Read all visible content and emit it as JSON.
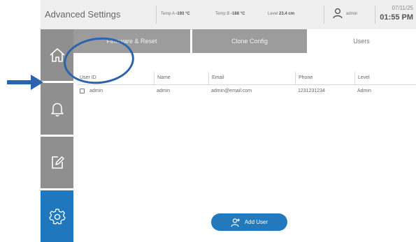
{
  "header": {
    "title": "Advanced Settings",
    "temp_a_label": "Temp A",
    "temp_a_value": "-193 °C",
    "temp_b_label": "Temp B",
    "temp_b_value": "-188 °C",
    "level_label": "Level",
    "level_value": "23.4 cm",
    "user": "admin",
    "date": "07/11/25",
    "time": "01:55 PM"
  },
  "sidebar": {
    "items": [
      {
        "name": "home",
        "icon": "home-icon",
        "active": false
      },
      {
        "name": "alarms",
        "icon": "bell-icon",
        "active": false
      },
      {
        "name": "logs",
        "icon": "edit-icon",
        "active": false
      },
      {
        "name": "settings",
        "icon": "gear-icon",
        "active": true
      }
    ]
  },
  "tabs": [
    {
      "label": "Firmware & Reset",
      "selected": false
    },
    {
      "label": "Clone Config",
      "selected": false
    },
    {
      "label": "Users",
      "selected": true
    }
  ],
  "table": {
    "columns": [
      "User ID",
      "Name",
      "Email",
      "Phone",
      "Level"
    ],
    "rows": [
      {
        "user_id": "admin",
        "name": "admin",
        "email": "admin@email.com",
        "phone": "1231231234",
        "level": "Admin"
      }
    ]
  },
  "add_user_button": {
    "label": "Add User",
    "icon": "add-user-icon"
  },
  "colors": {
    "accent": "#1f78be",
    "sidebar": "#8f8f8f",
    "tab_inactive": "#9c9c9c",
    "annotation": "#2a64b0"
  }
}
